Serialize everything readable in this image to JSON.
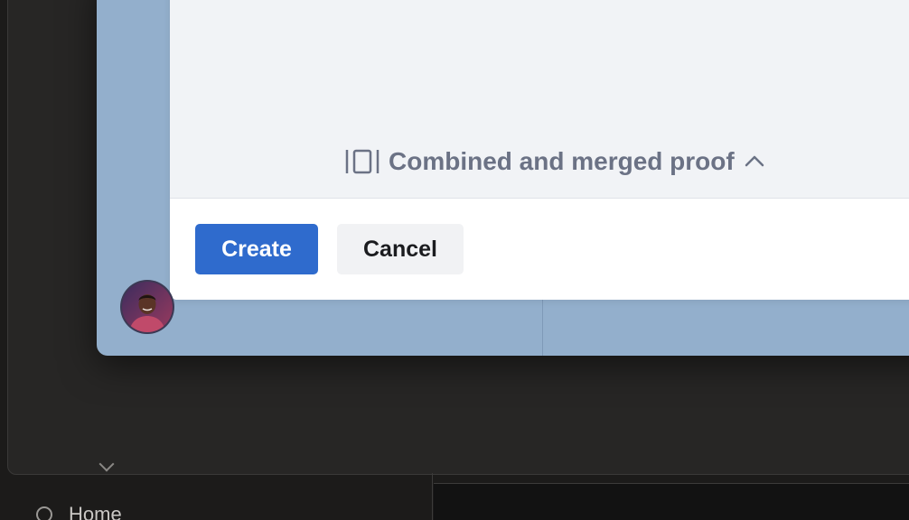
{
  "background_app": {
    "sidebar_item_label": "Home",
    "home_icon": "circle-icon"
  },
  "modal": {
    "proof_toggle": {
      "label": "Combined and merged proof",
      "icon": "columns-icon",
      "chevron_icon": "chevron-up-icon"
    },
    "footer": {
      "create_label": "Create",
      "cancel_label": "Cancel"
    }
  },
  "user": {
    "avatar_icon": "avatar"
  },
  "colors": {
    "primary": "#2f6bcd",
    "app_window": "#93afcc",
    "muted_text": "#6b7285"
  }
}
